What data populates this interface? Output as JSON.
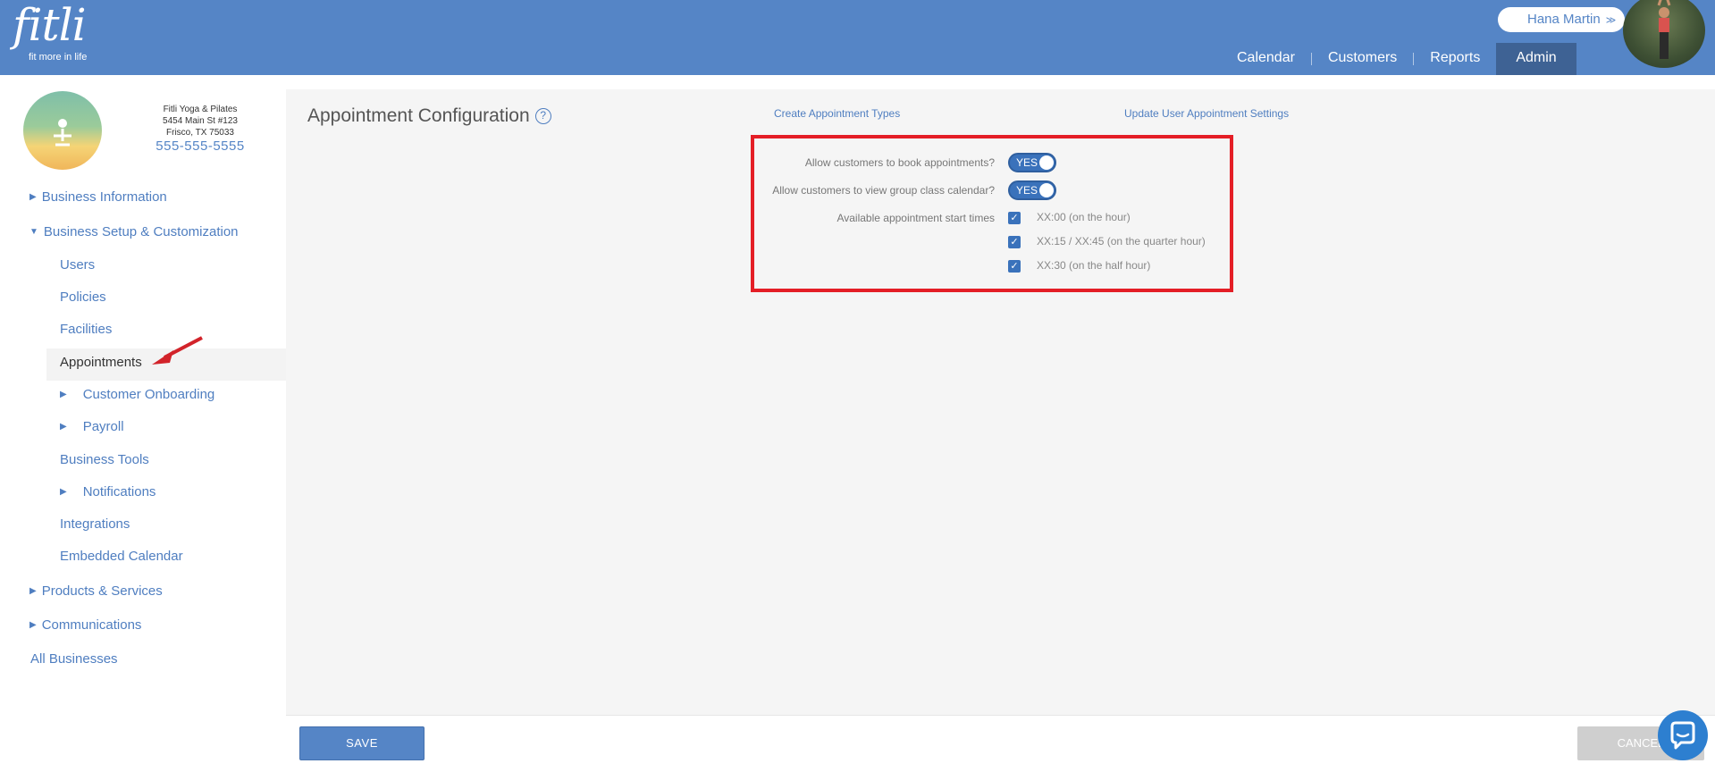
{
  "header": {
    "logo_word": "fitli",
    "logo_tagline": "fit more in life",
    "user_name": "Hana Martin",
    "nav": [
      {
        "label": "Calendar"
      },
      {
        "label": "Customers"
      },
      {
        "label": "Reports"
      },
      {
        "label": "Admin",
        "active": true
      }
    ]
  },
  "business": {
    "name": "Fitli Yoga & Pilates",
    "address1": "5454 Main St #123",
    "address2": "Frisco, TX 75033",
    "phone": "555-555-5555"
  },
  "sidebar": {
    "business_information": "Business Information",
    "business_setup": "Business Setup & Customization",
    "users": "Users",
    "policies": "Policies",
    "facilities": "Facilities",
    "appointments": "Appointments",
    "customer_onboarding": "Customer Onboarding",
    "payroll": "Payroll",
    "business_tools": "Business Tools",
    "notifications": "Notifications",
    "integrations": "Integrations",
    "embedded_calendar": "Embedded Calendar",
    "products_services": "Products & Services",
    "communications": "Communications",
    "all_businesses": "All Businesses"
  },
  "main": {
    "title": "Appointment Configuration",
    "create_link": "Create Appointment Types",
    "update_link": "Update User Appointment Settings",
    "book_label": "Allow customers to book appointments?",
    "book_toggle": "YES",
    "view_label": "Allow customers to view group class calendar?",
    "view_toggle": "YES",
    "times_label": "Available appointment start times",
    "time_options": [
      {
        "label": "XX:00 (on the hour)",
        "checked": true
      },
      {
        "label": "XX:15 / XX:45 (on the quarter hour)",
        "checked": true
      },
      {
        "label": "XX:30 (on the half hour)",
        "checked": true
      }
    ]
  },
  "footer": {
    "save_label": "SAVE",
    "cancel_label": "CANCEL"
  },
  "colors": {
    "header_bg": "#5585c6",
    "nav_active_bg": "#3e6294",
    "link": "#4f7ec0",
    "highlight_border": "#e41e26",
    "toggle_bg": "#3a72bb"
  }
}
